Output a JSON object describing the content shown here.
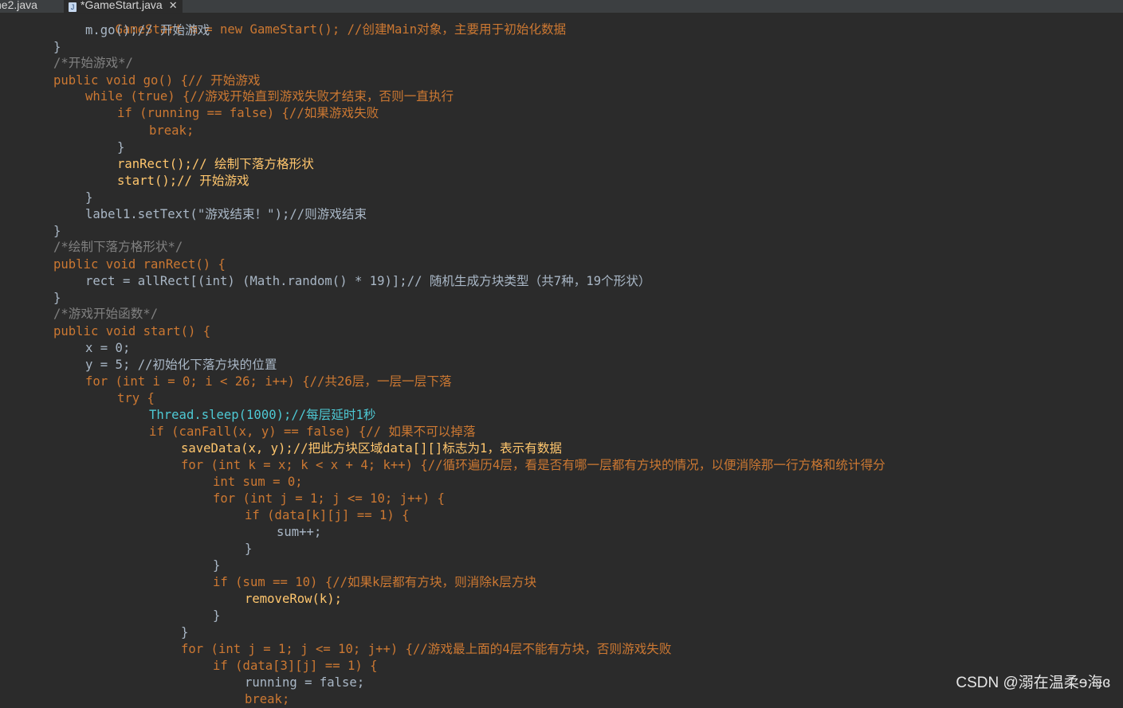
{
  "tabs": [
    {
      "label": "ne2.java"
    },
    {
      "label": "*GameStart.java",
      "close": "✕"
    }
  ],
  "code": {
    "l00": "GameStart m = new GameStart(); //创建Main对象，主要用于初始化数据",
    "l01": "m.go();// 开始游戏",
    "l02": "}",
    "l03": "/*开始游戏*/",
    "l04": "public void go() {// 开始游戏",
    "l05": "while (true) {//游戏开始直到游戏失败才结束，否则一直执行",
    "l06": "if (running == false) {//如果游戏失败",
    "l07": "break;",
    "l08": "}",
    "l09": "ranRect();// 绘制下落方格形状",
    "l10": "start();// 开始游戏",
    "l11": "}",
    "l12": "label1.setText(\"游戏结束！\");//则游戏结束",
    "l13": "}",
    "l14": "/*绘制下落方格形状*/",
    "l15": "public void ranRect() {",
    "l16": "rect = allRect[(int) (Math.random() * 19)];// 随机生成方块类型（共7种，19个形状）",
    "l17": "}",
    "l18": "/*游戏开始函数*/",
    "l19": "public void start() {",
    "l20": "x = 0;",
    "l21": "y = 5; //初始化下落方块的位置",
    "l22": "for (int i = 0; i < 26; i++) {//共26层，一层一层下落",
    "l23": "try {",
    "l24": "Thread.sleep(1000);//每层延时1秒",
    "l25": "if (canFall(x, y) == false) {// 如果不可以掉落",
    "l26": "saveData(x, y);//把此方块区域data[][]标志为1，表示有数据",
    "l27": "for (int k = x; k < x + 4; k++) {//循环遍历4层，看是否有哪一层都有方块的情况，以便消除那一行方格和统计得分",
    "l28": "int sum = 0;",
    "l29": "for (int j = 1; j <= 10; j++) {",
    "l30": "if (data[k][j] == 1) {",
    "l31": "sum++;",
    "l32": "}",
    "l33": "}",
    "l34": "if (sum == 10) {//如果k层都有方块，则消除k层方块",
    "l35": "removeRow(k);",
    "l36": "}",
    "l37": "}",
    "l38": "for (int j = 1; j <= 10; j++) {//游戏最上面的4层不能有方块，否则游戏失败",
    "l39": "if (data[3][j] == 1) {",
    "l40": "running = false;",
    "l41": "break;"
  },
  "watermark": "CSDN @溺在温柔ɘ海ɞ",
  "colors": {
    "background": "#2b2b2b",
    "keyword": "#cc7832",
    "method": "#ffc66d",
    "number": "#6897bb",
    "comment": "#808080",
    "string": "#4ec9b0"
  }
}
